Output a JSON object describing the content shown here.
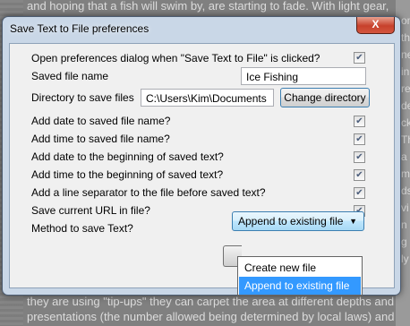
{
  "background": {
    "line_top": "and hoping that a fish will swim by, are starting to fade. With light gear,",
    "line_bottom_1": "they are using \"tip-ups\" they can carpet the area at different depths and",
    "line_bottom_2": "presentations (the number allowed being determined by local laws) and",
    "right_fragments": [
      "om",
      "th",
      "ne",
      "in",
      "re",
      "de",
      "ck",
      "Th",
      "a l",
      "m",
      "ds",
      "vi",
      "n",
      "g ",
      "ly"
    ]
  },
  "dialog": {
    "title": "Save Text to File preferences",
    "close_label": "X",
    "open_prefs_label": "Open preferences dialog when \"Save Text to File\" is clicked?",
    "open_prefs_checked": true,
    "file_name_label": "Saved file name",
    "file_name_value": "Ice Fishing",
    "directory_label": "Directory to save files",
    "directory_value": "C:\\Users\\Kim\\Documents",
    "change_directory_label": "Change directory",
    "options": [
      {
        "label": "Add date to saved file name?",
        "checked": true
      },
      {
        "label": "Add time to saved file name?",
        "checked": true
      },
      {
        "label": "Add date to the beginning of saved text?",
        "checked": true
      },
      {
        "label": "Add time to the beginning of saved text?",
        "checked": true
      },
      {
        "label": "Add a line separator to the file before saved text?",
        "checked": true
      },
      {
        "label": "Save current URL in file?",
        "checked": true
      }
    ],
    "method_label": "Method to save Text?",
    "method_selected": "Append to existing file",
    "method_options": [
      "Create new file",
      "Append to existing file"
    ],
    "highlight_color": "#3399ff"
  }
}
